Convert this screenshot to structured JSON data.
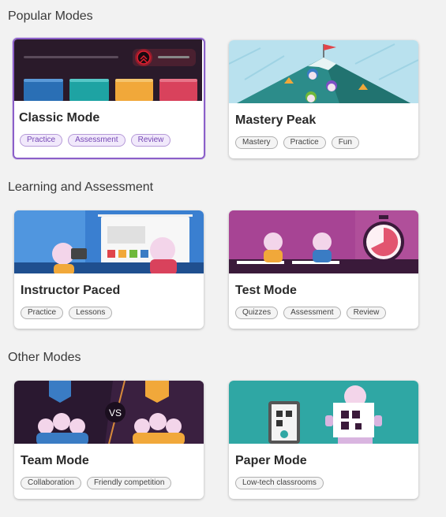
{
  "sections": [
    {
      "title": "Popular Modes",
      "cards": [
        {
          "title": "Classic Mode",
          "tags": [
            "Practice",
            "Assessment",
            "Review"
          ],
          "selected": true
        },
        {
          "title": "Mastery Peak",
          "tags": [
            "Mastery",
            "Practice",
            "Fun"
          ]
        }
      ]
    },
    {
      "title": "Learning and Assessment",
      "cards": [
        {
          "title": "Instructor Paced",
          "tags": [
            "Practice",
            "Lessons"
          ]
        },
        {
          "title": "Test Mode",
          "tags": [
            "Quizzes",
            "Assessment",
            "Review"
          ]
        }
      ]
    },
    {
      "title": "Other Modes",
      "cards": [
        {
          "title": "Team Mode",
          "tags": [
            "Collaboration",
            "Friendly competition"
          ]
        },
        {
          "title": "Paper Mode",
          "tags": [
            "Low-tech classrooms"
          ]
        }
      ]
    }
  ],
  "colors": {
    "selected_border": "#8b5fc9",
    "tag_selected_bg": "#f1e9fb",
    "tag_selected_text": "#7648b5"
  }
}
